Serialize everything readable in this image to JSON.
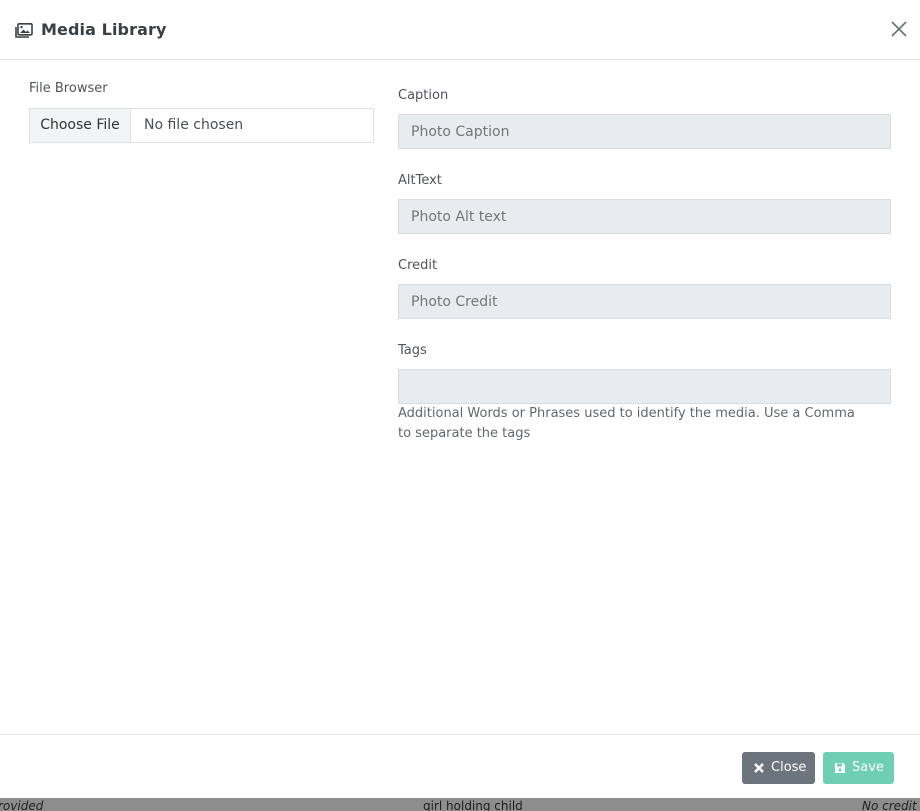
{
  "header": {
    "title": "Media Library",
    "title_icon": "images-icon",
    "close_icon": "close-icon"
  },
  "file_browser": {
    "label": "File Browser",
    "button_label": "Choose File",
    "status": "No file chosen"
  },
  "fields": {
    "caption": {
      "label": "Caption",
      "placeholder": "Photo Caption",
      "value": ""
    },
    "alttext": {
      "label": "AltText",
      "placeholder": "Photo Alt text",
      "value": ""
    },
    "credit": {
      "label": "Credit",
      "placeholder": "Photo Credit",
      "value": ""
    },
    "tags": {
      "label": "Tags",
      "placeholder": "",
      "value": "",
      "help": "Additional Words or Phrases used to identify the media. Use a Comma to separate the tags"
    }
  },
  "footer": {
    "close_label": "Close",
    "save_label": "Save"
  },
  "background": {
    "left_text": "rovided",
    "middle_text": "girl holding child",
    "right_text": "No credit"
  },
  "colors": {
    "close_button": "#6c757d",
    "save_button": "#6fcfb5",
    "field_bg": "#e9ecef"
  }
}
